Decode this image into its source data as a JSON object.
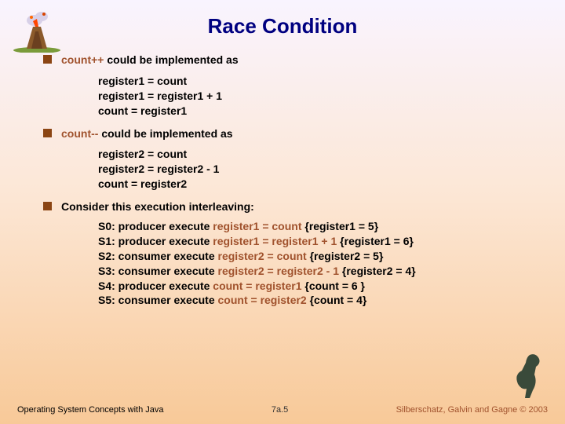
{
  "title": "Race Condition",
  "bullet1": {
    "prefix": "count++",
    "rest": " could be implemented as"
  },
  "code1": {
    "l1": "register1 = count",
    "l2": "register1 = register1 + 1",
    "l3": "count = register1"
  },
  "bullet2": {
    "prefix": "count--",
    "rest": " could be implemented as"
  },
  "code2": {
    "l1": "register2 = count",
    "l2": "register2 = register2 - 1",
    "l3": "count = register2"
  },
  "bullet3": "Consider this execution interleaving:",
  "steps": {
    "s0": {
      "a": "S0: producer execute ",
      "b": "register1 = count",
      "c": "   {register1 = 5}"
    },
    "s1": {
      "a": "S1: producer execute ",
      "b": "register1 = register1 + 1",
      "c": "   {register1 = 6}"
    },
    "s2": {
      "a": "S2: consumer execute ",
      "b": "register2 = count",
      "c": "   {register2 = 5}"
    },
    "s3": {
      "a": "S3: consumer execute ",
      "b": "register2 = register2 - 1",
      "c": "   {register2 = 4}"
    },
    "s4": {
      "a": "S4: producer execute ",
      "b": "count = register1",
      "c": "   {count = 6 }"
    },
    "s5": {
      "a": "S5: consumer execute ",
      "b": "count = register2",
      "c": "   {count = 4}"
    }
  },
  "footer": {
    "left": "Operating System Concepts with Java",
    "center": "7a.5",
    "right": "Silberschatz, Galvin and Gagne © 2003"
  }
}
